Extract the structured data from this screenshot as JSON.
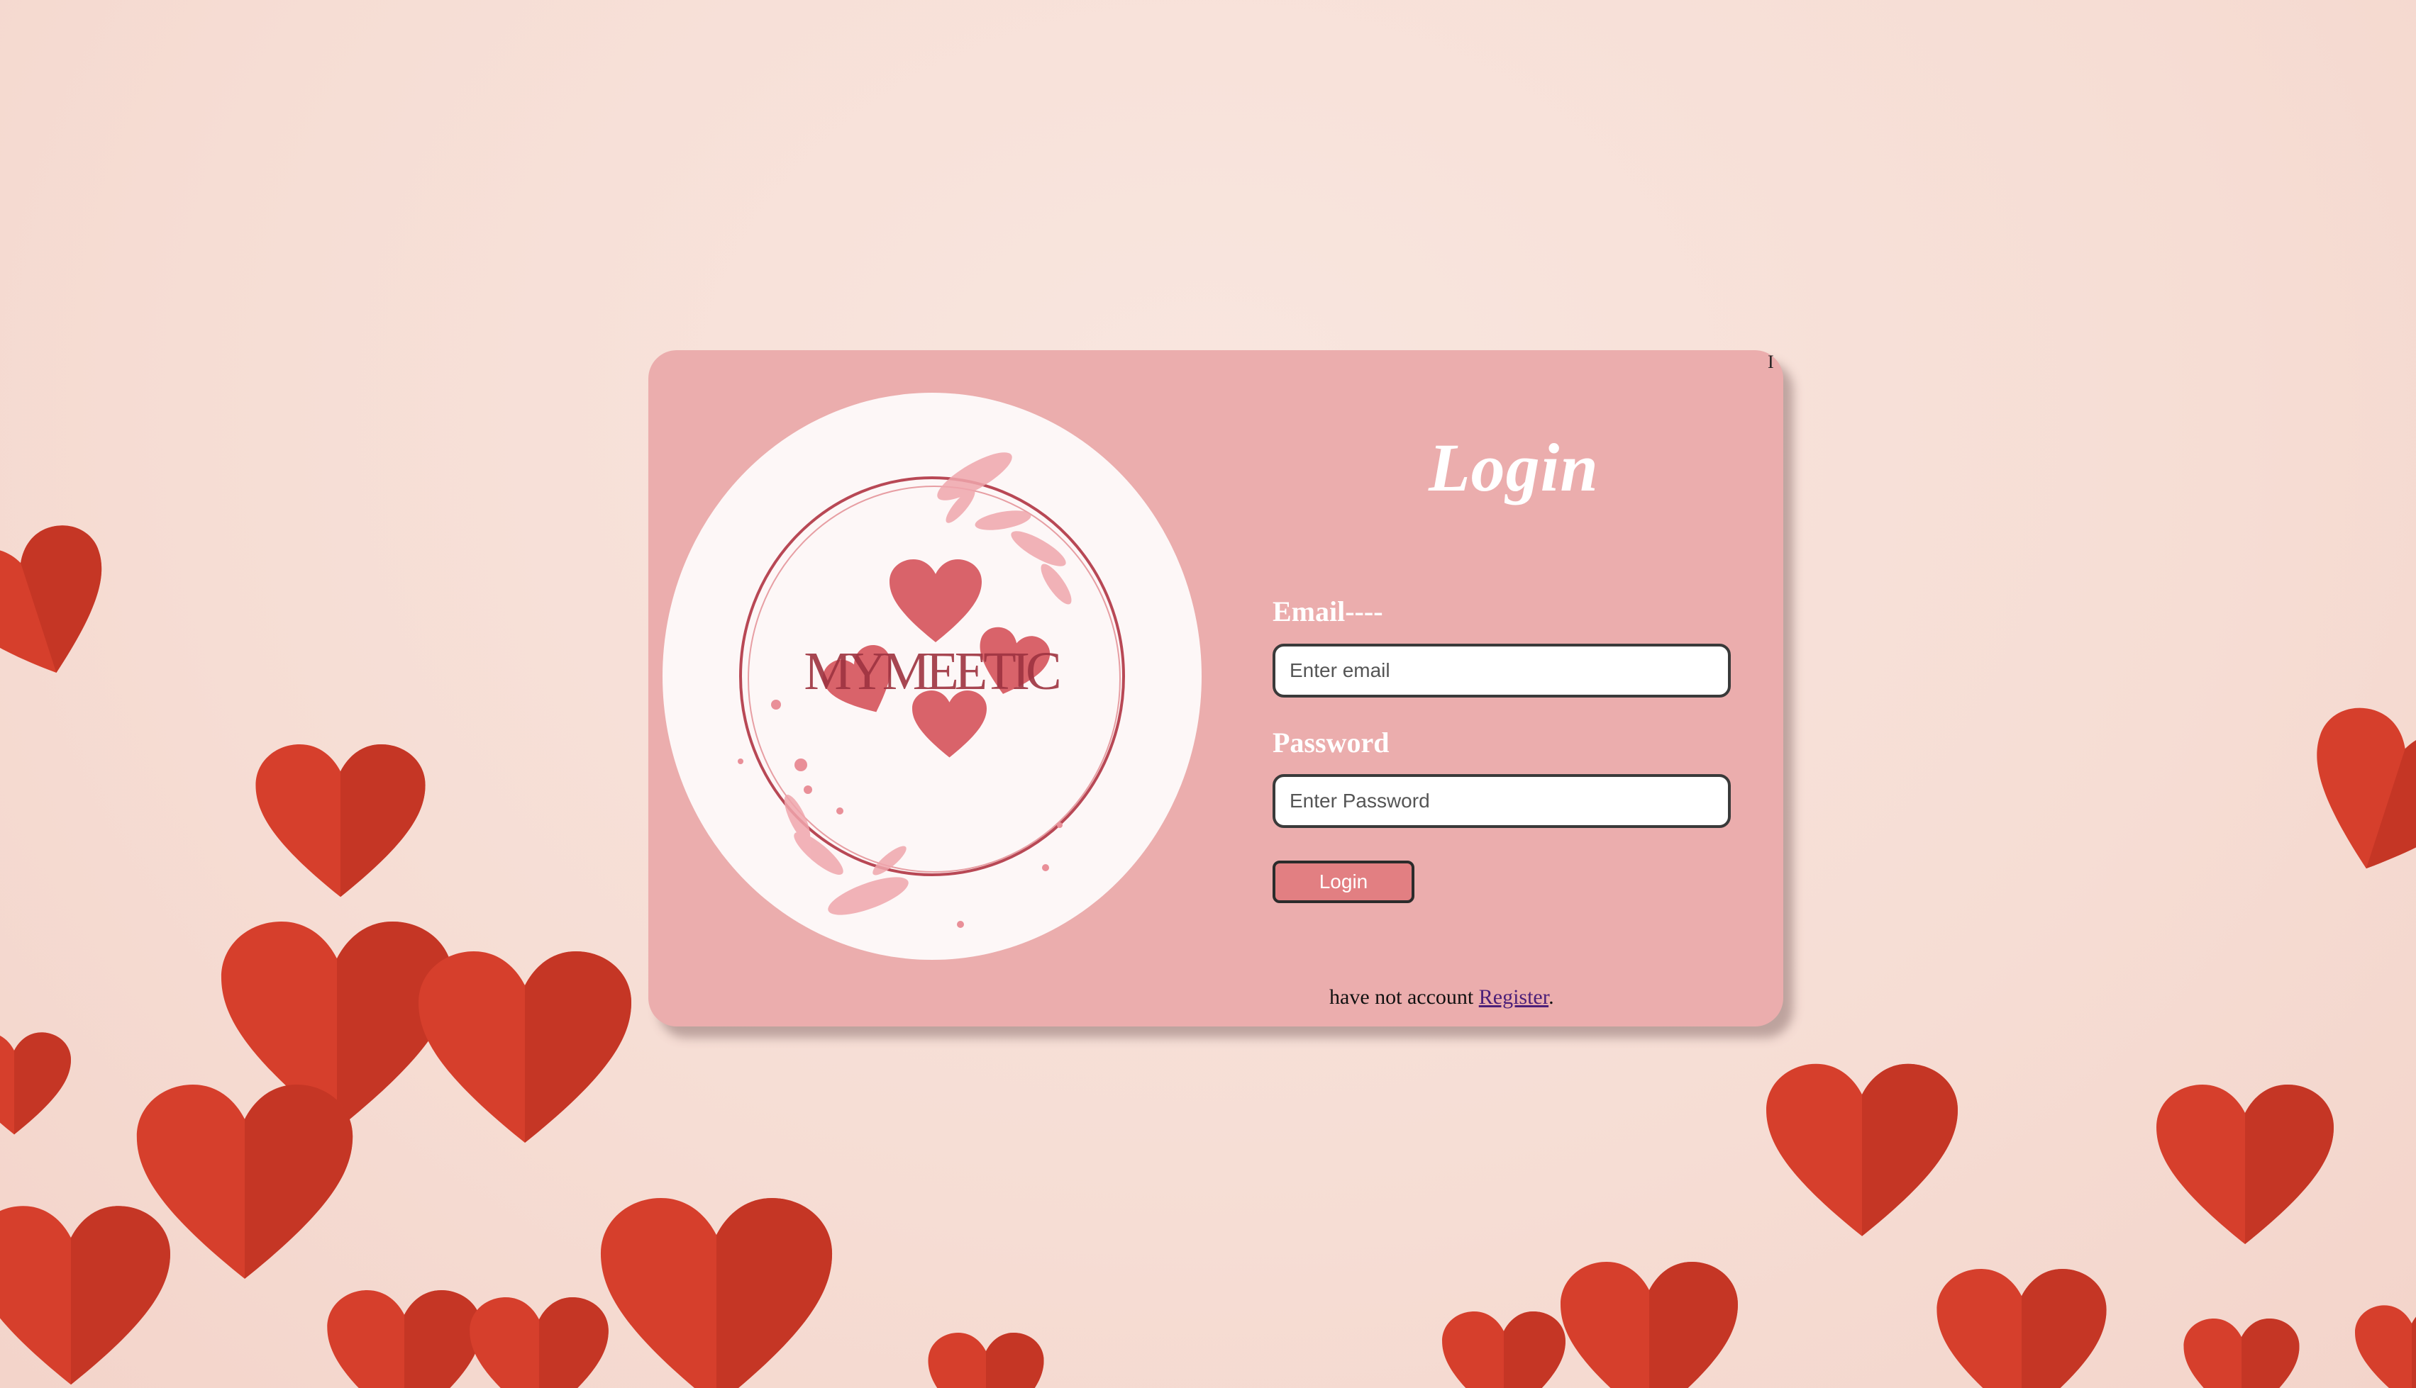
{
  "background": {
    "color": "#f7e3dc",
    "decoration": "paper-hearts",
    "heart_color": "#d63f2c"
  },
  "card": {
    "color": "#ebadad",
    "cursor_glyph": "I"
  },
  "logo": {
    "brand_text": "MYMEETIC",
    "icon": "hearts-wreath-logo",
    "accent_color": "#d9636a"
  },
  "login_form": {
    "title": "Login",
    "email_label": "Email----",
    "email_placeholder": "Enter email",
    "email_value": "",
    "password_label": "Password",
    "password_placeholder": "Enter Password",
    "password_value": "",
    "submit_label": "Login",
    "button_color": "#e27f82"
  },
  "register": {
    "prefix": "have not account",
    "link_label": "Register",
    "suffix": "."
  }
}
